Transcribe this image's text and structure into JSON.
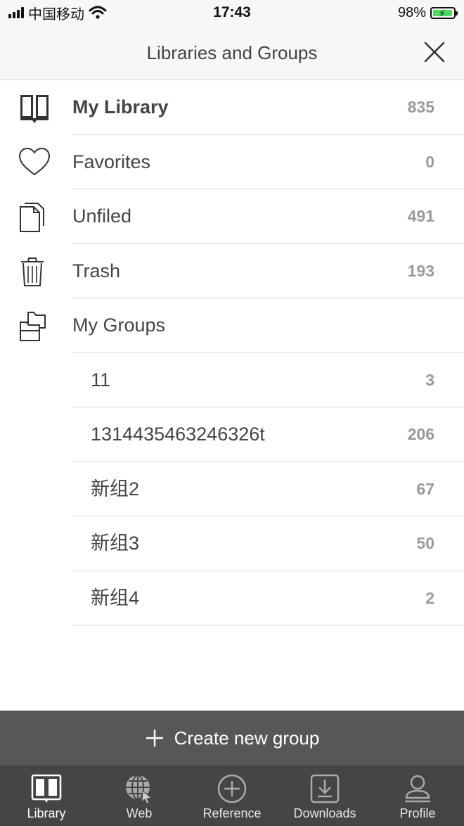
{
  "status_bar": {
    "carrier": "中国移动",
    "time": "17:43",
    "battery": "98%",
    "battery_level": 0.98
  },
  "header": {
    "title": "Libraries and Groups"
  },
  "library": [
    {
      "label": "My Library",
      "count": "835",
      "icon": "book-icon"
    },
    {
      "label": "Favorites",
      "count": "0",
      "icon": "heart-icon"
    },
    {
      "label": "Unfiled",
      "count": "491",
      "icon": "documents-icon"
    },
    {
      "label": "Trash",
      "count": "193",
      "icon": "trash-icon"
    }
  ],
  "groups": {
    "label": "My Groups",
    "icon": "folders-icon",
    "items": [
      {
        "label": "11",
        "count": "3"
      },
      {
        "label": "1314435463246326t",
        "count": "206"
      },
      {
        "label": "新组2",
        "count": "67"
      },
      {
        "label": "新组3",
        "count": "50"
      },
      {
        "label": "新组4",
        "count": "2"
      }
    ]
  },
  "create_group": {
    "label": "Create new group",
    "icon": "plus-icon"
  },
  "tabs": [
    {
      "label": "Library",
      "icon": "library-icon",
      "active": true
    },
    {
      "label": "Web",
      "icon": "globe-icon",
      "active": false
    },
    {
      "label": "Reference",
      "icon": "plus-circle-icon",
      "active": false
    },
    {
      "label": "Downloads",
      "icon": "download-icon",
      "active": false
    },
    {
      "label": "Profile",
      "icon": "profile-icon",
      "active": false
    }
  ],
  "colors": {
    "header_bg": "#f7f7f7",
    "create_bar_bg": "#575757",
    "tab_bar_bg": "#454545",
    "count_text": "#9a9a9a",
    "battery_fill": "#4cd964"
  }
}
